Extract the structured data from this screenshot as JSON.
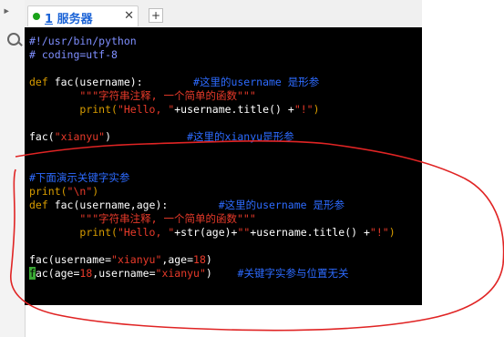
{
  "tab": {
    "number": "1",
    "title": "服务器",
    "close_symbol": "✕"
  },
  "new_tab_symbol": "+",
  "colors": {
    "keyword": "#d89c00",
    "string": "#e83a2a",
    "comment": "#2d6bff",
    "text": "#ffffff",
    "comment_gray": "#7f8fff",
    "annotation": "#e02424",
    "cursor": "#3aa835"
  },
  "code": {
    "l1": "#!/usr/bin/python",
    "l2": "# coding=utf-8",
    "l3_kw": "def",
    "l3_fn": " fac(username):",
    "l3_comment": "        #这里的username 是形参",
    "l4_doc": "        \"\"\"字符串注释, 一个简单的函数\"\"\"",
    "l5_indent": "        ",
    "l5_print": "print(",
    "l5_str1": "\"Hello, \"",
    "l5_rest": "+username.title() +",
    "l5_str2": "\"!\"",
    "l5_close": ")",
    "l6_call": "fac(",
    "l6_str": "\"xianyu\"",
    "l6_close": ")",
    "l6_comment": "            #这里的xianyu是形参",
    "l7_comment": "#下面演示关键字实参",
    "l8_print": "print(",
    "l8_str": "\"\\n\"",
    "l8_close": ")",
    "l9_kw": "def",
    "l9_fn": " fac(username,age):",
    "l9_comment": "        #这里的username 是形参",
    "l10_doc": "        \"\"\"字符串注释, 一个简单的函数\"\"\"",
    "l11_indent": "        ",
    "l11_print": "print(",
    "l11_str1": "\"Hello, \"",
    "l11_mid": "+str(age)+",
    "l11_str2": "\"\"",
    "l11_rest": "+username.title() +",
    "l11_str3": "\"!\"",
    "l11_close": ")",
    "l12_a": "fac(username=",
    "l12_str": "\"xianyu\"",
    "l12_b": ",age=",
    "l12_num": "18",
    "l12_c": ")",
    "l13_cursor": "f",
    "l13_a": "ac(age=",
    "l13_num": "18",
    "l13_b": ",username=",
    "l13_str": "\"xianyu\"",
    "l13_c": ")",
    "l13_comment": "    #关键字实参与位置无关"
  }
}
